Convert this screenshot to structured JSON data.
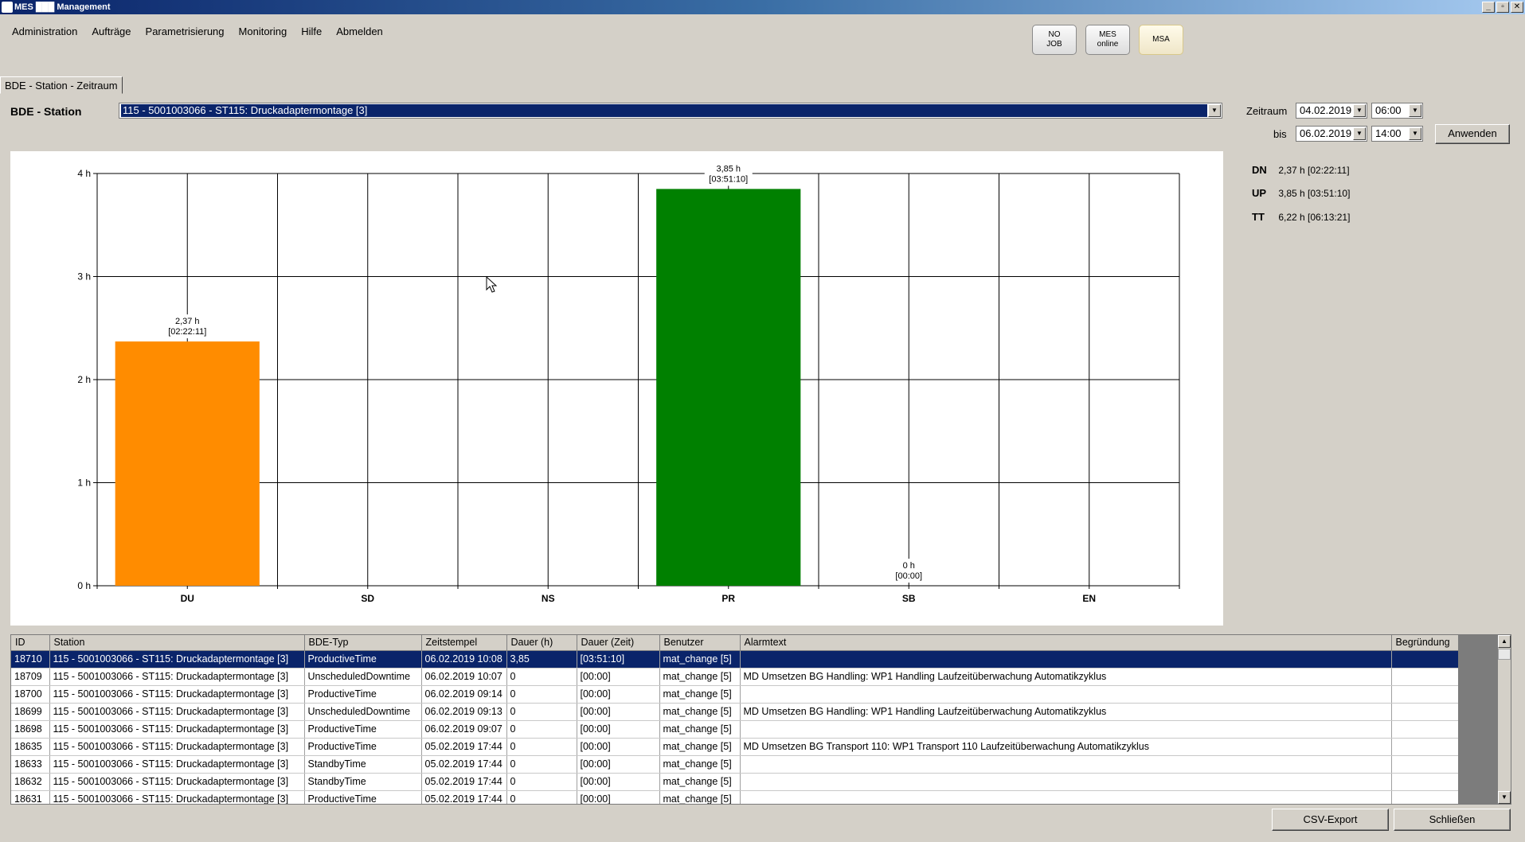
{
  "window": {
    "title": "MES ███ Management",
    "buttons": [
      "_",
      "▫",
      "✕"
    ]
  },
  "menu": [
    "Administration",
    "Aufträge",
    "Parametrisierung",
    "Monitoring",
    "Hilfe",
    "Abmelden"
  ],
  "status_buttons": {
    "no_job": [
      "NO",
      "JOB"
    ],
    "mes_online": [
      "MES",
      "online"
    ],
    "msa": "MSA"
  },
  "tab": {
    "label": "BDE - Station - Zeitraum"
  },
  "station": {
    "label": "BDE - Station",
    "value": "115 - 5001003066 - ST115: Druckadaptermontage [3]"
  },
  "zeitraum": {
    "label": "Zeitraum",
    "from_date": "04.02.2019",
    "from_time": "06:00",
    "to_label": "bis",
    "to_date": "06.02.2019",
    "to_time": "14:00",
    "apply_label": "Anwenden"
  },
  "summary": [
    {
      "key": "DN",
      "value": "2,37 h [02:22:11]"
    },
    {
      "key": "UP",
      "value": "3,85 h [03:51:10]"
    },
    {
      "key": "TT",
      "value": "6,22 h [06:13:21]"
    }
  ],
  "colors": {
    "DU": "#ff8c00",
    "PR": "#008000",
    "selection": "#0a246a"
  },
  "chart_data": {
    "type": "bar",
    "categories": [
      "DU",
      "SD",
      "NS",
      "PR",
      "SB",
      "EN"
    ],
    "values": [
      2.37,
      null,
      null,
      3.85,
      0,
      null
    ],
    "data_labels": [
      [
        "2,37 h",
        "[02:22:11]"
      ],
      null,
      null,
      [
        "3,85 h",
        "[03:51:10]"
      ],
      [
        "0 h",
        "[00:00]"
      ],
      null
    ],
    "bar_colors": [
      "#ff8c00",
      null,
      null,
      "#008000",
      null,
      null
    ],
    "y_ticks": [
      "0 h",
      "1 h",
      "2 h",
      "3 h",
      "4 h"
    ],
    "ylim": [
      0,
      4
    ],
    "grid": true
  },
  "table": {
    "columns": [
      "ID",
      "Station",
      "BDE-Typ",
      "Zeitstempel",
      "Dauer (h)",
      "Dauer (Zeit)",
      "Benutzer",
      "Alarmtext",
      "Begründung"
    ],
    "rows": [
      [
        "18710",
        "115 - 5001003066 - ST115: Druckadaptermontage [3]",
        "ProductiveTime",
        "06.02.2019 10:08",
        "3,85",
        "[03:51:10]",
        "mat_change [5]",
        "",
        ""
      ],
      [
        "18709",
        "115 - 5001003066 - ST115: Druckadaptermontage [3]",
        "UnscheduledDowntime",
        "06.02.2019 10:07",
        "0",
        "[00:00]",
        "mat_change [5]",
        "MD Umsetzen BG Handling: WP1 Handling Laufzeitüberwachung Automatikzyklus",
        ""
      ],
      [
        "18700",
        "115 - 5001003066 - ST115: Druckadaptermontage [3]",
        "ProductiveTime",
        "06.02.2019 09:14",
        "0",
        "[00:00]",
        "mat_change [5]",
        "",
        ""
      ],
      [
        "18699",
        "115 - 5001003066 - ST115: Druckadaptermontage [3]",
        "UnscheduledDowntime",
        "06.02.2019 09:13",
        "0",
        "[00:00]",
        "mat_change [5]",
        "MD Umsetzen BG Handling: WP1 Handling Laufzeitüberwachung Automatikzyklus",
        ""
      ],
      [
        "18698",
        "115 - 5001003066 - ST115: Druckadaptermontage [3]",
        "ProductiveTime",
        "06.02.2019 09:07",
        "0",
        "[00:00]",
        "mat_change [5]",
        "",
        ""
      ],
      [
        "18635",
        "115 - 5001003066 - ST115: Druckadaptermontage [3]",
        "ProductiveTime",
        "05.02.2019 17:44",
        "0",
        "[00:00]",
        "mat_change [5]",
        "MD Umsetzen BG Transport 110: WP1 Transport 110 Laufzeitüberwachung Automatikzyklus",
        ""
      ],
      [
        "18633",
        "115 - 5001003066 - ST115: Druckadaptermontage [3]",
        "StandbyTime",
        "05.02.2019 17:44",
        "0",
        "[00:00]",
        "mat_change [5]",
        "",
        ""
      ],
      [
        "18632",
        "115 - 5001003066 - ST115: Druckadaptermontage [3]",
        "StandbyTime",
        "05.02.2019 17:44",
        "0",
        "[00:00]",
        "mat_change [5]",
        "",
        ""
      ],
      [
        "18631",
        "115 - 5001003066 - ST115: Druckadaptermontage [3]",
        "ProductiveTime",
        "05.02.2019 17:44",
        "0",
        "[00:00]",
        "mat_change [5]",
        "",
        ""
      ]
    ]
  },
  "footer": {
    "csv_label": "CSV-Export",
    "close_label": "Schließen"
  }
}
